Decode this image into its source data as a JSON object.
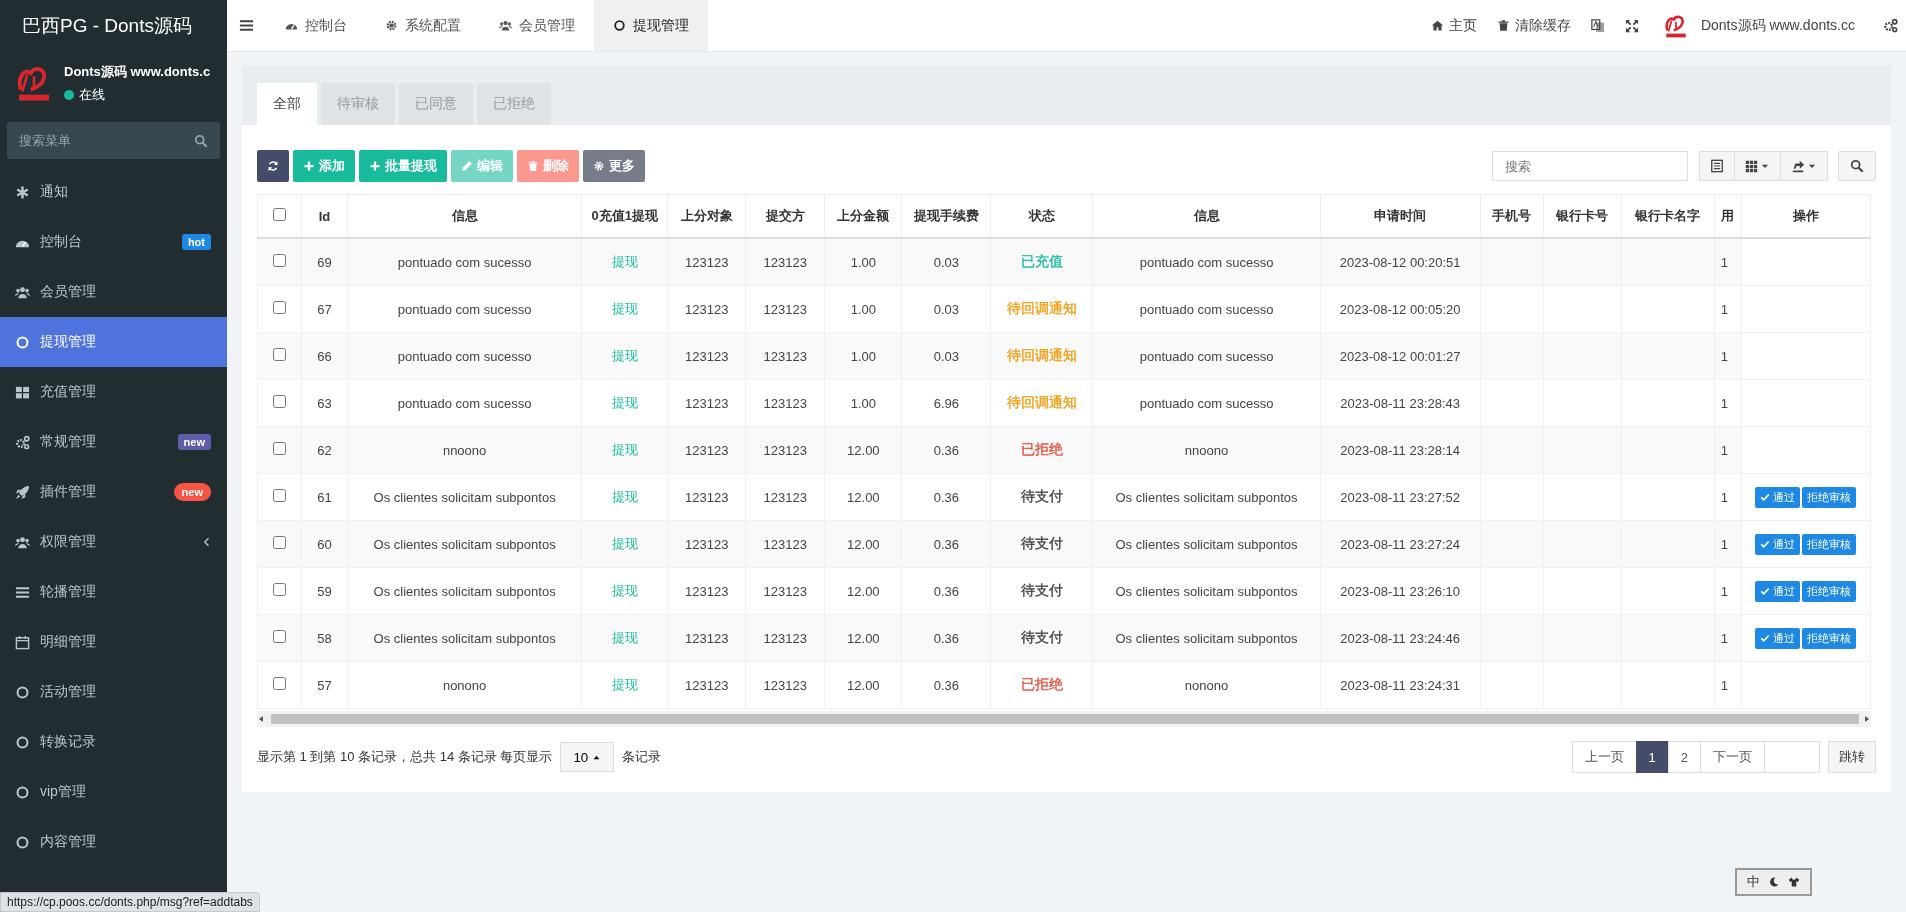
{
  "sidebar": {
    "title": "巴西PG - Donts源码",
    "user": {
      "name": "Donts源码 www.donts.c",
      "status": "在线",
      "online": true
    },
    "search": {
      "placeholder": "搜索菜单"
    },
    "items": [
      {
        "label": "通知",
        "selected": false
      },
      {
        "label": "控制台",
        "selected": false,
        "badge": {
          "text": "hot",
          "color": "#1e88e5"
        }
      },
      {
        "label": "会员管理",
        "selected": false
      },
      {
        "label": "提现管理",
        "selected": true
      },
      {
        "label": "充值管理",
        "selected": false
      },
      {
        "label": "常规管理",
        "selected": false,
        "badge": {
          "text": "new",
          "color": "#605ca8"
        }
      },
      {
        "label": "插件管理",
        "selected": false,
        "badge": {
          "text": "new",
          "color": "#f75444"
        }
      },
      {
        "label": "权限管理",
        "selected": false,
        "expandable": true
      },
      {
        "label": "轮播管理",
        "selected": false
      },
      {
        "label": "明细管理",
        "selected": false
      },
      {
        "label": "活动管理",
        "selected": false
      },
      {
        "label": "转换记录",
        "selected": false
      },
      {
        "label": "vip管理",
        "selected": false
      },
      {
        "label": "内容管理",
        "selected": false
      }
    ]
  },
  "topbar": {
    "tabs": [
      {
        "label": "控制台",
        "selected": false
      },
      {
        "label": "系统配置",
        "selected": false
      },
      {
        "label": "会员管理",
        "selected": false
      },
      {
        "label": "提现管理",
        "selected": true
      }
    ],
    "links": [
      {
        "kind": "home",
        "label": "主页"
      },
      {
        "kind": "clear",
        "label": "清除缓存"
      }
    ],
    "brand": "Donts源码 www.donts.cc"
  },
  "panel": {
    "filter_tabs": [
      {
        "label": "全部",
        "selected": true
      },
      {
        "label": "待审核",
        "selected": false
      },
      {
        "label": "已同意",
        "selected": false
      },
      {
        "label": "已拒绝",
        "selected": false
      }
    ],
    "toolbar": {
      "buttons": [
        {
          "kind": "refresh",
          "disabled": false
        },
        {
          "kind": "add",
          "label": "添加",
          "disabled": false
        },
        {
          "kind": "batch",
          "label": "批量提现",
          "disabled": false
        },
        {
          "kind": "edit",
          "label": "编辑",
          "disabled": true
        },
        {
          "kind": "delete",
          "label": "删除",
          "disabled": true
        },
        {
          "kind": "more",
          "label": "更多",
          "disabled": false
        }
      ],
      "search": {
        "placeholder": "搜索"
      }
    },
    "table": {
      "select_all": {
        "checked": false
      },
      "columns": [
        "Id",
        "信息",
        "0充值1提现",
        "上分对象",
        "提交方",
        "上分金额",
        "提现手续费",
        "状态",
        "信息",
        "申请时间",
        "手机号",
        "银行卡号",
        "银行卡名字",
        "用",
        "操作"
      ],
      "rows": [
        {
          "checked": false,
          "id": "69",
          "info": "pontuado com sucesso",
          "type": "提现",
          "target": "123123",
          "submitter": "123123",
          "amount": "1.00",
          "fee": "0.03",
          "status": {
            "text": "已充值",
            "color": "#18bc9c"
          },
          "info_2": "pontuado com sucesso",
          "time": "2023-08-12 00:20:51",
          "user": "1"
        },
        {
          "checked": false,
          "id": "67",
          "info": "pontuado com sucesso",
          "type": "提现",
          "target": "123123",
          "submitter": "123123",
          "amount": "1.00",
          "fee": "0.03",
          "status": {
            "text": "待回调通知",
            "color": "#f39c12"
          },
          "info_2": "pontuado com sucesso",
          "time": "2023-08-12 00:05:20",
          "user": "1"
        },
        {
          "checked": false,
          "id": "66",
          "info": "pontuado com sucesso",
          "type": "提现",
          "target": "123123",
          "submitter": "123123",
          "amount": "1.00",
          "fee": "0.03",
          "status": {
            "text": "待回调通知",
            "color": "#f39c12"
          },
          "info_2": "pontuado com sucesso",
          "time": "2023-08-12 00:01:27",
          "user": "1"
        },
        {
          "checked": false,
          "id": "63",
          "info": "pontuado com sucesso",
          "type": "提现",
          "target": "123123",
          "submitter": "123123",
          "amount": "1.00",
          "fee": "6.96",
          "status": {
            "text": "待回调通知",
            "color": "#f39c12"
          },
          "info_2": "pontuado com sucesso",
          "time": "2023-08-11 23:28:43",
          "user": "1"
        },
        {
          "checked": false,
          "id": "62",
          "info": "nnoono",
          "type": "提现",
          "target": "123123",
          "submitter": "123123",
          "amount": "12.00",
          "fee": "0.36",
          "status": {
            "text": "已拒绝",
            "color": "#e74c3c"
          },
          "info_2": "nnoono",
          "time": "2023-08-11 23:28:14",
          "user": "1"
        },
        {
          "checked": false,
          "id": "61",
          "info": "Os clientes solicitam subpontos",
          "type": "提现",
          "target": "123123",
          "submitter": "123123",
          "amount": "12.00",
          "fee": "0.36",
          "status": {
            "text": "待支付",
            "color": "#444444"
          },
          "info_2": "Os clientes solicitam subpontos",
          "time": "2023-08-11 23:27:52",
          "user": "1",
          "actions": [
            {
              "kind": "approve",
              "label": "通过"
            },
            {
              "kind": "reject",
              "label": "拒绝审核"
            }
          ]
        },
        {
          "checked": false,
          "id": "60",
          "info": "Os clientes solicitam subpontos",
          "type": "提现",
          "target": "123123",
          "submitter": "123123",
          "amount": "12.00",
          "fee": "0.36",
          "status": {
            "text": "待支付",
            "color": "#444444"
          },
          "info_2": "Os clientes solicitam subpontos",
          "time": "2023-08-11 23:27:24",
          "user": "1",
          "actions": [
            {
              "kind": "approve",
              "label": "通过"
            },
            {
              "kind": "reject",
              "label": "拒绝审核"
            }
          ]
        },
        {
          "checked": false,
          "id": "59",
          "info": "Os clientes solicitam subpontos",
          "type": "提现",
          "target": "123123",
          "submitter": "123123",
          "amount": "12.00",
          "fee": "0.36",
          "status": {
            "text": "待支付",
            "color": "#444444"
          },
          "info_2": "Os clientes solicitam subpontos",
          "time": "2023-08-11 23:26:10",
          "user": "1",
          "actions": [
            {
              "kind": "approve",
              "label": "通过"
            },
            {
              "kind": "reject",
              "label": "拒绝审核"
            }
          ]
        },
        {
          "checked": false,
          "id": "58",
          "info": "Os clientes solicitam subpontos",
          "type": "提现",
          "target": "123123",
          "submitter": "123123",
          "amount": "12.00",
          "fee": "0.36",
          "status": {
            "text": "待支付",
            "color": "#444444"
          },
          "info_2": "Os clientes solicitam subpontos",
          "time": "2023-08-11 23:24:46",
          "user": "1",
          "actions": [
            {
              "kind": "approve",
              "label": "通过"
            },
            {
              "kind": "reject",
              "label": "拒绝审核"
            }
          ]
        },
        {
          "checked": false,
          "id": "57",
          "info": "nonono",
          "type": "提现",
          "target": "123123",
          "submitter": "123123",
          "amount": "12.00",
          "fee": "0.36",
          "status": {
            "text": "已拒绝",
            "color": "#e74c3c"
          },
          "info_2": "nonono",
          "time": "2023-08-11 23:24:31",
          "user": "1"
        }
      ]
    },
    "pagination": {
      "summary": "显示第 1 到第 10 条记录，总共 14 条记录 每页显示",
      "page_size": "10",
      "summary_suffix": "条记录",
      "pages": [
        {
          "label": "上一页",
          "selected": false
        },
        {
          "label": "1",
          "selected": true
        },
        {
          "label": "2",
          "selected": false
        },
        {
          "label": "下一页",
          "selected": false
        }
      ],
      "jump": "跳转"
    }
  },
  "ime_bar": {
    "label": "中"
  },
  "status_url": "https://cp.poos.cc/donts.php/msg?ref=addtabs"
}
